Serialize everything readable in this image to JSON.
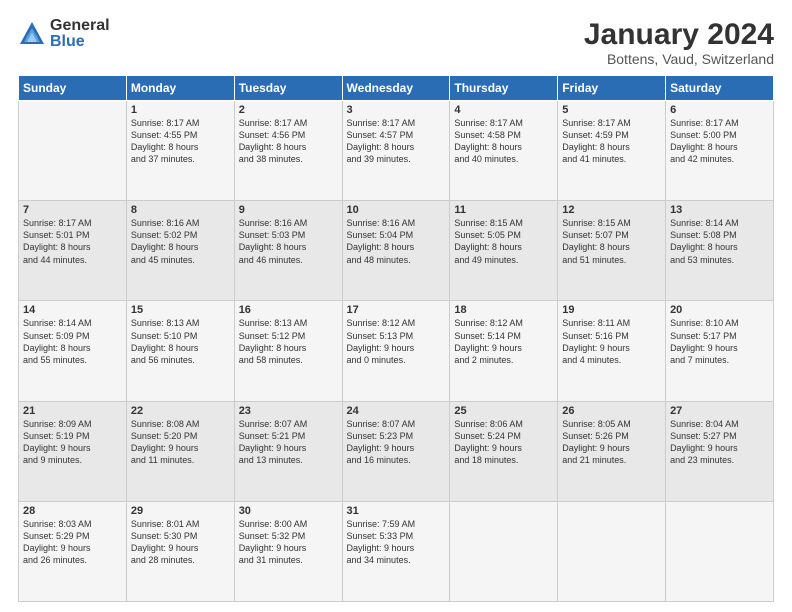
{
  "logo": {
    "general": "General",
    "blue": "Blue"
  },
  "title": "January 2024",
  "subtitle": "Bottens, Vaud, Switzerland",
  "days_of_week": [
    "Sunday",
    "Monday",
    "Tuesday",
    "Wednesday",
    "Thursday",
    "Friday",
    "Saturday"
  ],
  "weeks": [
    [
      {
        "day": "",
        "info": ""
      },
      {
        "day": "1",
        "info": "Sunrise: 8:17 AM\nSunset: 4:55 PM\nDaylight: 8 hours\nand 37 minutes."
      },
      {
        "day": "2",
        "info": "Sunrise: 8:17 AM\nSunset: 4:56 PM\nDaylight: 8 hours\nand 38 minutes."
      },
      {
        "day": "3",
        "info": "Sunrise: 8:17 AM\nSunset: 4:57 PM\nDaylight: 8 hours\nand 39 minutes."
      },
      {
        "day": "4",
        "info": "Sunrise: 8:17 AM\nSunset: 4:58 PM\nDaylight: 8 hours\nand 40 minutes."
      },
      {
        "day": "5",
        "info": "Sunrise: 8:17 AM\nSunset: 4:59 PM\nDaylight: 8 hours\nand 41 minutes."
      },
      {
        "day": "6",
        "info": "Sunrise: 8:17 AM\nSunset: 5:00 PM\nDaylight: 8 hours\nand 42 minutes."
      }
    ],
    [
      {
        "day": "7",
        "info": "Sunrise: 8:17 AM\nSunset: 5:01 PM\nDaylight: 8 hours\nand 44 minutes."
      },
      {
        "day": "8",
        "info": "Sunrise: 8:16 AM\nSunset: 5:02 PM\nDaylight: 8 hours\nand 45 minutes."
      },
      {
        "day": "9",
        "info": "Sunrise: 8:16 AM\nSunset: 5:03 PM\nDaylight: 8 hours\nand 46 minutes."
      },
      {
        "day": "10",
        "info": "Sunrise: 8:16 AM\nSunset: 5:04 PM\nDaylight: 8 hours\nand 48 minutes."
      },
      {
        "day": "11",
        "info": "Sunrise: 8:15 AM\nSunset: 5:05 PM\nDaylight: 8 hours\nand 49 minutes."
      },
      {
        "day": "12",
        "info": "Sunrise: 8:15 AM\nSunset: 5:07 PM\nDaylight: 8 hours\nand 51 minutes."
      },
      {
        "day": "13",
        "info": "Sunrise: 8:14 AM\nSunset: 5:08 PM\nDaylight: 8 hours\nand 53 minutes."
      }
    ],
    [
      {
        "day": "14",
        "info": "Sunrise: 8:14 AM\nSunset: 5:09 PM\nDaylight: 8 hours\nand 55 minutes."
      },
      {
        "day": "15",
        "info": "Sunrise: 8:13 AM\nSunset: 5:10 PM\nDaylight: 8 hours\nand 56 minutes."
      },
      {
        "day": "16",
        "info": "Sunrise: 8:13 AM\nSunset: 5:12 PM\nDaylight: 8 hours\nand 58 minutes."
      },
      {
        "day": "17",
        "info": "Sunrise: 8:12 AM\nSunset: 5:13 PM\nDaylight: 9 hours\nand 0 minutes."
      },
      {
        "day": "18",
        "info": "Sunrise: 8:12 AM\nSunset: 5:14 PM\nDaylight: 9 hours\nand 2 minutes."
      },
      {
        "day": "19",
        "info": "Sunrise: 8:11 AM\nSunset: 5:16 PM\nDaylight: 9 hours\nand 4 minutes."
      },
      {
        "day": "20",
        "info": "Sunrise: 8:10 AM\nSunset: 5:17 PM\nDaylight: 9 hours\nand 7 minutes."
      }
    ],
    [
      {
        "day": "21",
        "info": "Sunrise: 8:09 AM\nSunset: 5:19 PM\nDaylight: 9 hours\nand 9 minutes."
      },
      {
        "day": "22",
        "info": "Sunrise: 8:08 AM\nSunset: 5:20 PM\nDaylight: 9 hours\nand 11 minutes."
      },
      {
        "day": "23",
        "info": "Sunrise: 8:07 AM\nSunset: 5:21 PM\nDaylight: 9 hours\nand 13 minutes."
      },
      {
        "day": "24",
        "info": "Sunrise: 8:07 AM\nSunset: 5:23 PM\nDaylight: 9 hours\nand 16 minutes."
      },
      {
        "day": "25",
        "info": "Sunrise: 8:06 AM\nSunset: 5:24 PM\nDaylight: 9 hours\nand 18 minutes."
      },
      {
        "day": "26",
        "info": "Sunrise: 8:05 AM\nSunset: 5:26 PM\nDaylight: 9 hours\nand 21 minutes."
      },
      {
        "day": "27",
        "info": "Sunrise: 8:04 AM\nSunset: 5:27 PM\nDaylight: 9 hours\nand 23 minutes."
      }
    ],
    [
      {
        "day": "28",
        "info": "Sunrise: 8:03 AM\nSunset: 5:29 PM\nDaylight: 9 hours\nand 26 minutes."
      },
      {
        "day": "29",
        "info": "Sunrise: 8:01 AM\nSunset: 5:30 PM\nDaylight: 9 hours\nand 28 minutes."
      },
      {
        "day": "30",
        "info": "Sunrise: 8:00 AM\nSunset: 5:32 PM\nDaylight: 9 hours\nand 31 minutes."
      },
      {
        "day": "31",
        "info": "Sunrise: 7:59 AM\nSunset: 5:33 PM\nDaylight: 9 hours\nand 34 minutes."
      },
      {
        "day": "",
        "info": ""
      },
      {
        "day": "",
        "info": ""
      },
      {
        "day": "",
        "info": ""
      }
    ]
  ]
}
